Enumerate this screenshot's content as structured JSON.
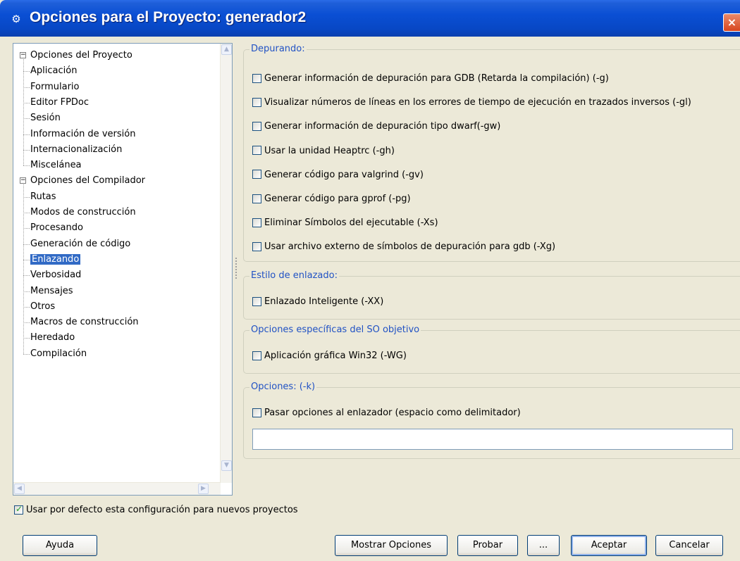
{
  "window": {
    "title": "Opciones para el Proyecto: generador2",
    "app_icon": "gear-icon",
    "close_label": "×"
  },
  "tree": {
    "groups": [
      {
        "label": "Opciones del Proyecto",
        "expanded": true,
        "items": [
          "Aplicación",
          "Formulario",
          "Editor FPDoc",
          "Sesión",
          "Información de versión",
          "Internacionalización",
          "Miscelánea"
        ]
      },
      {
        "label": "Opciones del Compilador",
        "expanded": true,
        "items": [
          "Rutas",
          "Modos de construcción",
          "Procesando",
          "Generación de código",
          "Enlazando",
          "Verbosidad",
          "Mensajes",
          "Otros",
          "Macros de construcción",
          "Heredado",
          "Compilación"
        ]
      }
    ],
    "selected": "Enlazando",
    "expand_glyph": "−"
  },
  "groups": {
    "depurando": {
      "legend": "Depurando:",
      "options": [
        {
          "label": "Generar información de depuración para GDB (Retarda la compilación) (-g)",
          "checked": false
        },
        {
          "label": "Visualizar números de líneas en los errores de tiempo de ejecución en trazados inversos (-gl)",
          "checked": false
        },
        {
          "label": "Generar información de depuración tipo dwarf(-gw)",
          "checked": false
        },
        {
          "label": "Usar la unidad Heaptrc (-gh)",
          "checked": false
        },
        {
          "label": "Generar código para valgrind (-gv)",
          "checked": false
        },
        {
          "label": "Generar código para gprof (-pg)",
          "checked": false
        },
        {
          "label": "Eliminar Símbolos del ejecutable (-Xs)",
          "checked": false
        },
        {
          "label": "Usar archivo externo de símbolos de depuración para gdb (-Xg)",
          "checked": false
        }
      ]
    },
    "estilo": {
      "legend": "Estilo de enlazado:",
      "options": [
        {
          "label": "Enlazado Inteligente (-XX)",
          "checked": false
        }
      ]
    },
    "so": {
      "legend": "Opciones específicas del SO objetivo",
      "options": [
        {
          "label": "Aplicación gráfica Win32 (-WG)",
          "checked": false
        }
      ]
    },
    "opciones": {
      "legend": "Opciones: (-k)",
      "options": [
        {
          "label": "Pasar opciones al enlazador (espacio como delimitador)",
          "checked": false
        }
      ],
      "input_value": ""
    }
  },
  "default_config": {
    "label": "Usar por defecto esta configuración para nuevos proyectos",
    "checked": true
  },
  "buttons": {
    "help": "Ayuda",
    "show_options": "Mostrar Opciones",
    "test": "Probar",
    "more": "...",
    "accept": "Aceptar",
    "cancel": "Cancelar"
  }
}
